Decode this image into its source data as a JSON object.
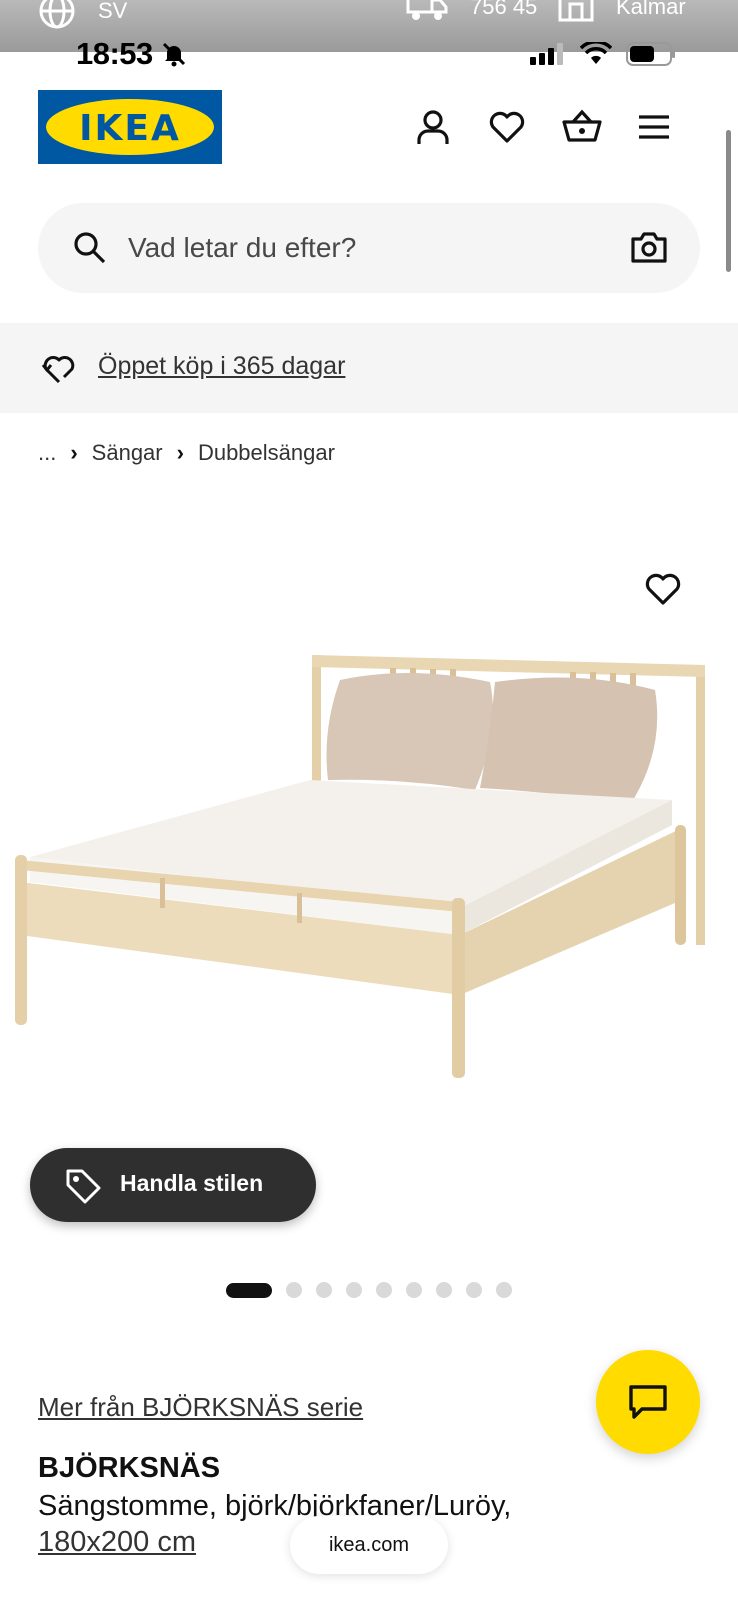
{
  "top_strip": {
    "language": "SV",
    "postal_code": "756 45",
    "store": "Kalmar"
  },
  "status_bar": {
    "time": "18:53"
  },
  "header": {
    "logo_text": "IKEA"
  },
  "search": {
    "placeholder": "Vad letar du efter?"
  },
  "promo": {
    "text": "Öppet köp i 365 dagar"
  },
  "breadcrumb": {
    "ellipsis": "...",
    "items": [
      "Sängar",
      "Dubbelsängar"
    ]
  },
  "gallery": {
    "shop_style_label": "Handla stilen",
    "image_count": 9,
    "active_index": 0
  },
  "product": {
    "series_link": "Mer från BJÖRKSNÄS serie",
    "name": "BJÖRKSNÄS",
    "description": "Sängstomme, björk/björkfaner/Luröy,",
    "size": "180x200 cm"
  },
  "browser": {
    "url": "ikea.com"
  },
  "colors": {
    "ikea_blue": "#0058a3",
    "ikea_yellow": "#ffdb00",
    "dark_button": "#2f2f2f"
  }
}
